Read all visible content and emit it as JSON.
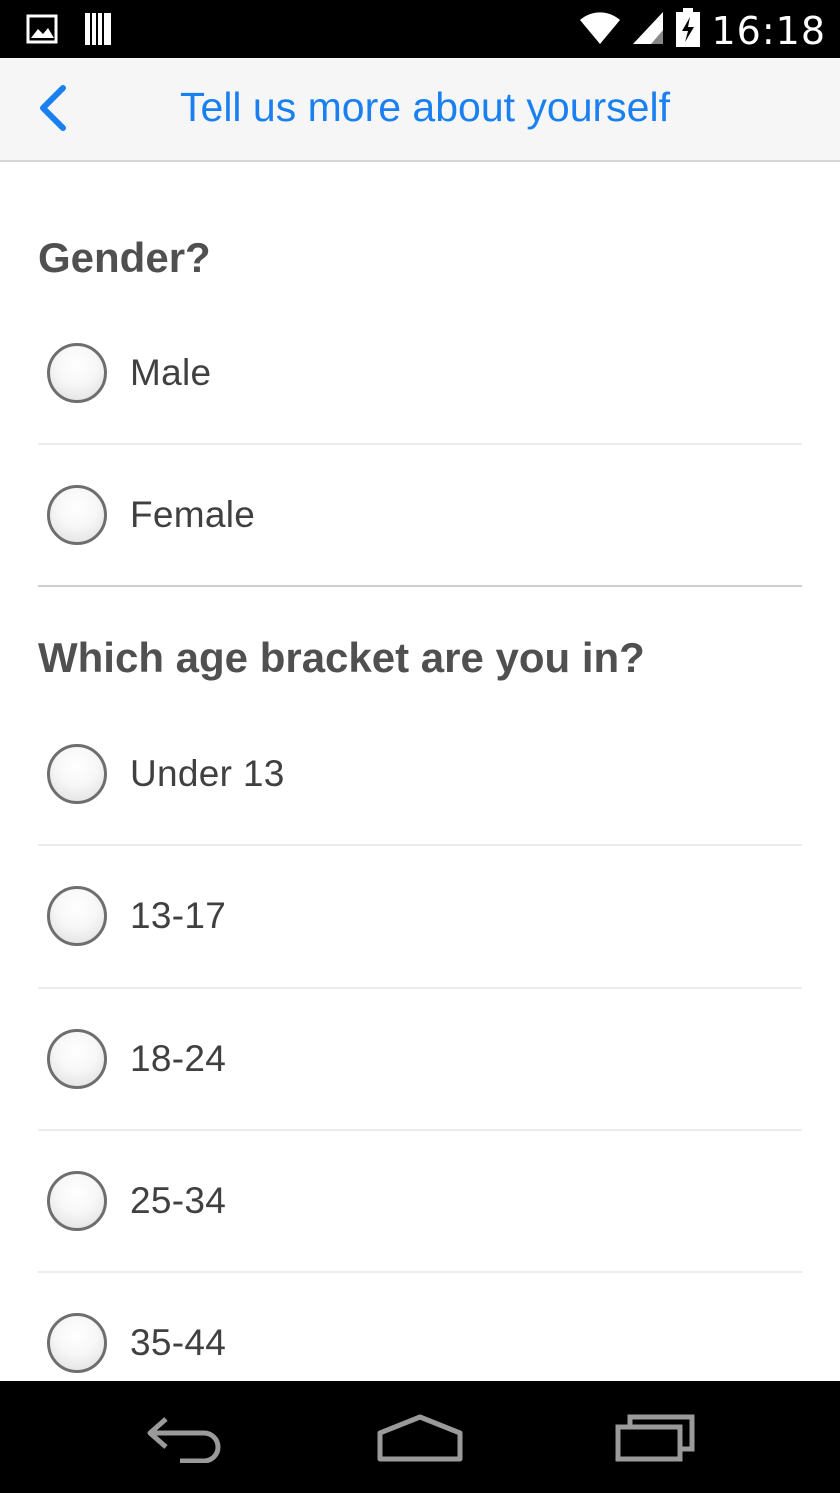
{
  "status_bar": {
    "time": "16:18",
    "icons": [
      "image-icon",
      "storage-icon",
      "wifi-icon",
      "signal-icon",
      "battery-charging-icon"
    ]
  },
  "app_bar": {
    "back_icon": "chevron-left-icon",
    "title": "Tell us more about yourself"
  },
  "questions": {
    "gender": {
      "label": "Gender?",
      "options": [
        "Male",
        "Female"
      ]
    },
    "age": {
      "label": "Which age bracket are you in?",
      "options": [
        "Under 13",
        "13-17",
        "18-24",
        "25-34",
        "35-44"
      ]
    }
  },
  "nav_bar": {
    "icons": [
      "back-icon",
      "home-icon",
      "recent-apps-icon"
    ]
  },
  "colors": {
    "accent": "#1a80f0",
    "question_text": "#505050",
    "option_text": "#404040",
    "app_bar_bg": "#f6f6f6"
  }
}
